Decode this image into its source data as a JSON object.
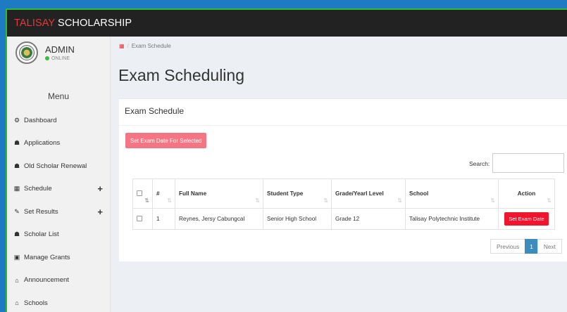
{
  "app": {
    "brand_accent": "TALISAY",
    "brand_rest": " SCHOLARSHIP"
  },
  "user": {
    "name": "ADMIN",
    "status": "ONLINE"
  },
  "sidebar": {
    "menu_label": "Menu",
    "items": [
      {
        "label": "Dashboard",
        "icon": "dashboard-icon",
        "glyph": "⚙"
      },
      {
        "label": "Applications",
        "icon": "users-icon",
        "glyph": "☗"
      },
      {
        "label": "Old Scholar Renewal",
        "icon": "users-icon",
        "glyph": "☗"
      },
      {
        "label": "Schedule",
        "icon": "calendar-icon",
        "glyph": "▦",
        "expand": "+"
      },
      {
        "label": "Set Results",
        "icon": "pencil-icon",
        "glyph": "✎",
        "expand": "+"
      },
      {
        "label": "Scholar List",
        "icon": "users-icon",
        "glyph": "☗"
      },
      {
        "label": "Manage Grants",
        "icon": "money-icon",
        "glyph": "▣"
      },
      {
        "label": "Announcement",
        "icon": "home-icon",
        "glyph": "⌂"
      },
      {
        "label": "Schools",
        "icon": "home-icon",
        "glyph": "⌂"
      }
    ]
  },
  "breadcrumb": {
    "sep": "/",
    "current": "Exam Schedule"
  },
  "page": {
    "title": "Exam Scheduling"
  },
  "box": {
    "title": "Exam Schedule",
    "bulk_button": "Set Exam Date For Selected",
    "search_label": "Search:",
    "search_value": ""
  },
  "table": {
    "headers": [
      "#",
      "Full Name",
      "Student Type",
      "Grade/Yearl Level",
      "School",
      "Action"
    ],
    "rows": [
      {
        "num": "1",
        "full_name": "Reynes, Jersy Cabungcal",
        "student_type": "Senior High School",
        "grade": "Grade 12",
        "school": "Talisay Polytechnic Institute",
        "action": "Set Exam Date"
      }
    ]
  },
  "pagination": {
    "previous": "Previous",
    "current": "1",
    "next": "Next"
  },
  "colors": {
    "accent": "#e8373a",
    "topbar": "#222222",
    "bulk_button": "#f57682",
    "action_button": "#f0142d",
    "active_page": "#3c8dbc",
    "frame_border": "#34b934",
    "outer_background": "#1f7ac4"
  }
}
